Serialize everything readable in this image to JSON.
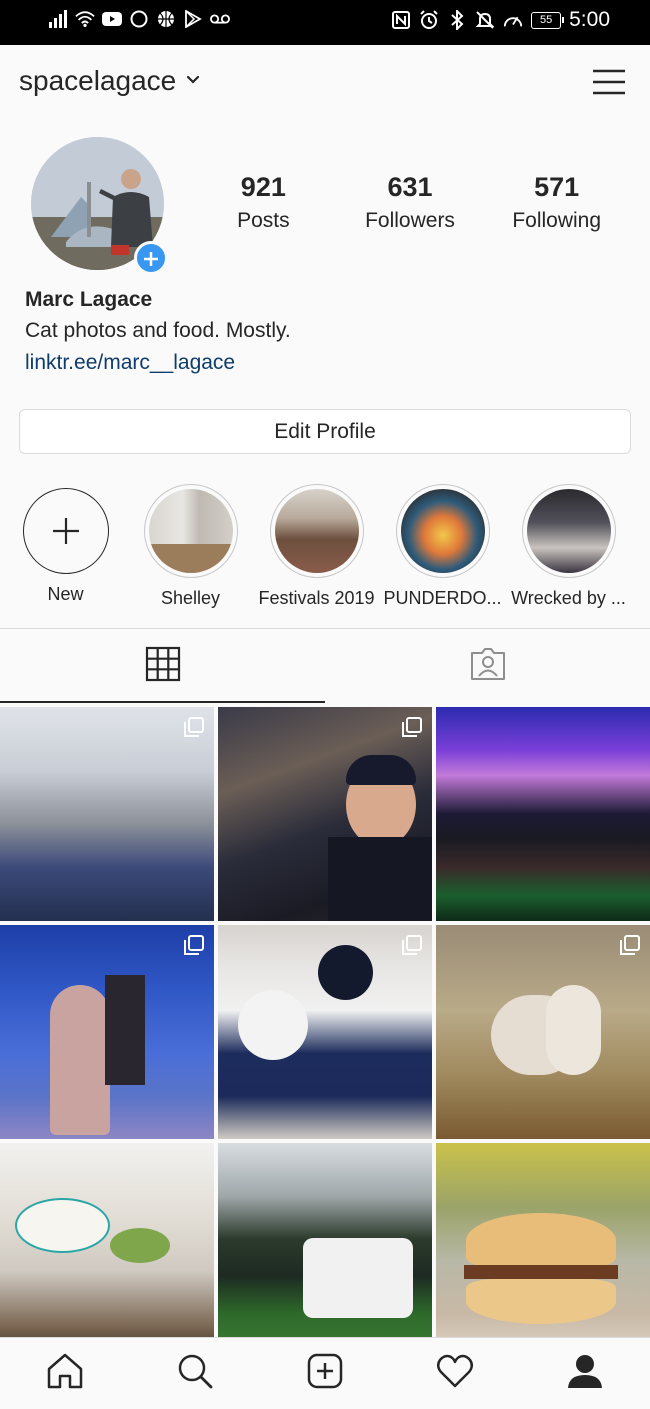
{
  "status_bar": {
    "battery": "55",
    "time": "5:00"
  },
  "header": {
    "username": "spacelagace"
  },
  "profile": {
    "stats": [
      {
        "value": "921",
        "label": "Posts"
      },
      {
        "value": "631",
        "label": "Followers"
      },
      {
        "value": "571",
        "label": "Following"
      }
    ],
    "name": "Marc Lagace",
    "bio": "Cat photos and food. Mostly.",
    "link": "linktr.ee/marc__lagace",
    "edit_label": "Edit Profile"
  },
  "highlights": [
    {
      "label": "New"
    },
    {
      "label": "Shelley"
    },
    {
      "label": "Festivals 2019"
    },
    {
      "label": "PUNDERDO..."
    },
    {
      "label": "Wrecked by ..."
    }
  ],
  "colors": {
    "accent_blue": "#3897f0",
    "link": "#0f3d6b",
    "text": "#262626",
    "divider": "#dbdbdb"
  }
}
